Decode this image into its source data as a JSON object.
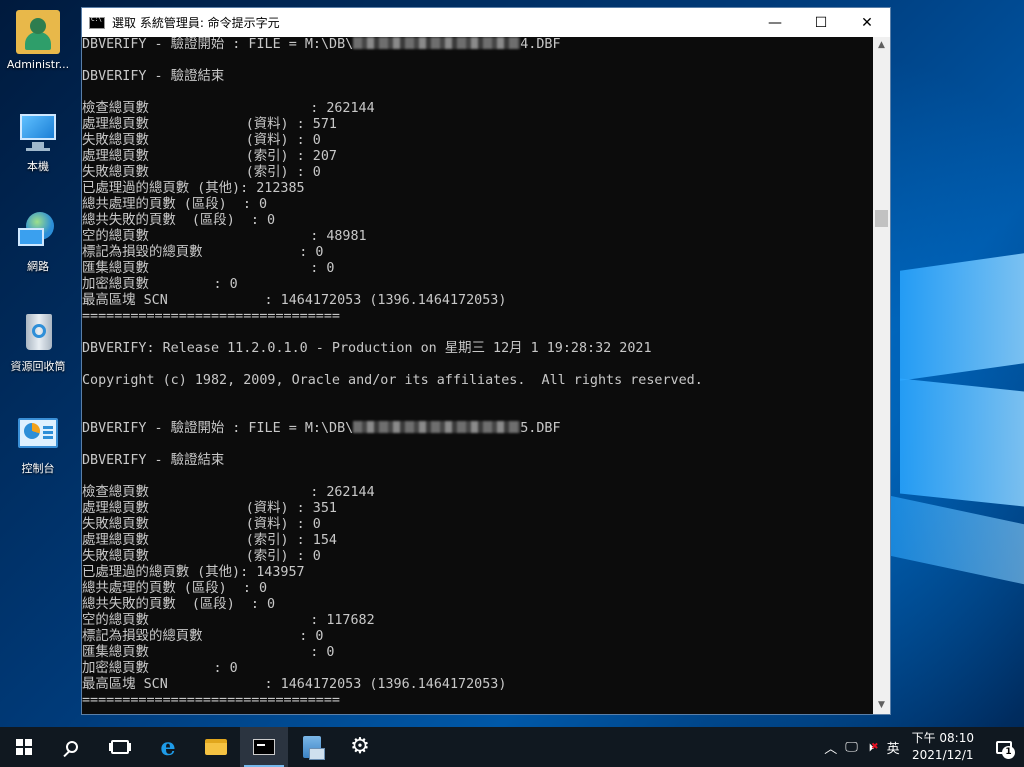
{
  "desktop": {
    "icons": [
      {
        "label": "Administr..."
      },
      {
        "label": "本機"
      },
      {
        "label": "網路"
      },
      {
        "label": "資源回收筒"
      },
      {
        "label": "控制台"
      }
    ]
  },
  "window": {
    "title": "選取 系統管理員: 命令提示字元",
    "minimize": "—",
    "maximize": "☐",
    "close": "✕"
  },
  "console": {
    "lines": [
      {
        "pre": "DBVERIFY - 驗證開始 : FILE = M:\\DB\\",
        "masked": true,
        "post": "4.DBF"
      },
      {
        "text": ""
      },
      {
        "text": "DBVERIFY - 驗證結束"
      },
      {
        "text": ""
      },
      {
        "text": "檢查總頁數                    : 262144"
      },
      {
        "text": "處理總頁數            (資料) : 571"
      },
      {
        "text": "失敗總頁數            (資料) : 0"
      },
      {
        "text": "處理總頁數            (索引) : 207"
      },
      {
        "text": "失敗總頁數            (索引) : 0"
      },
      {
        "text": "已處理過的總頁數 (其他): 212385"
      },
      {
        "text": "總共處理的頁數 (區段)  : 0"
      },
      {
        "text": "總共失敗的頁數  (區段)  : 0"
      },
      {
        "text": "空的總頁數                    : 48981"
      },
      {
        "text": "標記為損毀的總頁數            : 0"
      },
      {
        "text": "匯集總頁數                    : 0"
      },
      {
        "text": "加密總頁數        : 0"
      },
      {
        "text": "最高區塊 SCN            : 1464172053 (1396.1464172053)"
      },
      {
        "text": "================================"
      },
      {
        "text": ""
      },
      {
        "text": "DBVERIFY: Release 11.2.0.1.0 - Production on 星期三 12月 1 19:28:32 2021"
      },
      {
        "text": ""
      },
      {
        "text": "Copyright (c) 1982, 2009, Oracle and/or its affiliates.  All rights reserved."
      },
      {
        "text": ""
      },
      {
        "text": ""
      },
      {
        "pre": "DBVERIFY - 驗證開始 : FILE = M:\\DB\\",
        "masked": true,
        "post": "5.DBF"
      },
      {
        "text": ""
      },
      {
        "text": "DBVERIFY - 驗證結束"
      },
      {
        "text": ""
      },
      {
        "text": "檢查總頁數                    : 262144"
      },
      {
        "text": "處理總頁數            (資料) : 351"
      },
      {
        "text": "失敗總頁數            (資料) : 0"
      },
      {
        "text": "處理總頁數            (索引) : 154"
      },
      {
        "text": "失敗總頁數            (索引) : 0"
      },
      {
        "text": "已處理過的總頁數 (其他): 143957"
      },
      {
        "text": "總共處理的頁數 (區段)  : 0"
      },
      {
        "text": "總共失敗的頁數  (區段)  : 0"
      },
      {
        "text": "空的總頁數                    : 117682"
      },
      {
        "text": "標記為損毀的總頁數            : 0"
      },
      {
        "text": "匯集總頁數                    : 0"
      },
      {
        "text": "加密總頁數        : 0"
      },
      {
        "text": "最高區塊 SCN            : 1464172053 (1396.1464172053)"
      },
      {
        "text": "================================"
      }
    ]
  },
  "scrollbar": {
    "up": "▲",
    "down": "▼"
  },
  "taskbar": {
    "tray": {
      "chevron": "︿",
      "ime": "英",
      "time": "下午 08:10",
      "date": "2021/12/1",
      "notification_count": "1"
    }
  }
}
